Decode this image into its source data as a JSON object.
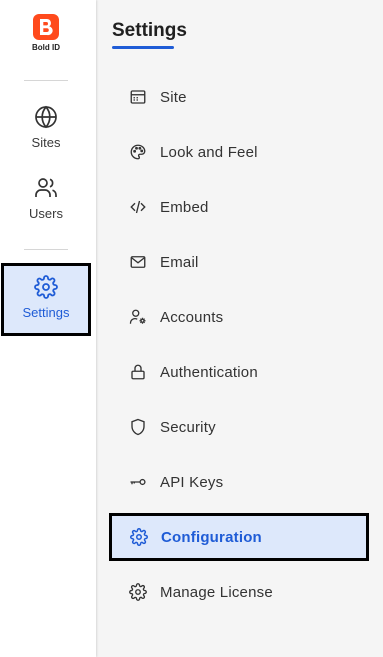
{
  "app": {
    "logo_text": "Bold ID",
    "brand_color": "#ff4a1c",
    "accent_color": "#1f5cd6"
  },
  "rail": {
    "items": [
      {
        "label": "Sites",
        "icon": "globe-icon"
      },
      {
        "label": "Users",
        "icon": "users-icon"
      },
      {
        "label": "Settings",
        "icon": "gear-icon",
        "active": true
      }
    ]
  },
  "settings": {
    "title": "Settings",
    "items": [
      {
        "label": "Site",
        "icon": "site-icon"
      },
      {
        "label": "Look and Feel",
        "icon": "palette-icon"
      },
      {
        "label": "Embed",
        "icon": "code-icon"
      },
      {
        "label": "Email",
        "icon": "mail-icon"
      },
      {
        "label": "Accounts",
        "icon": "accounts-icon"
      },
      {
        "label": "Authentication",
        "icon": "lock-icon"
      },
      {
        "label": "Security",
        "icon": "shield-icon"
      },
      {
        "label": "API Keys",
        "icon": "key-icon"
      },
      {
        "label": "Configuration",
        "icon": "gear-icon",
        "active": true
      },
      {
        "label": "Manage License",
        "icon": "license-icon"
      }
    ]
  }
}
